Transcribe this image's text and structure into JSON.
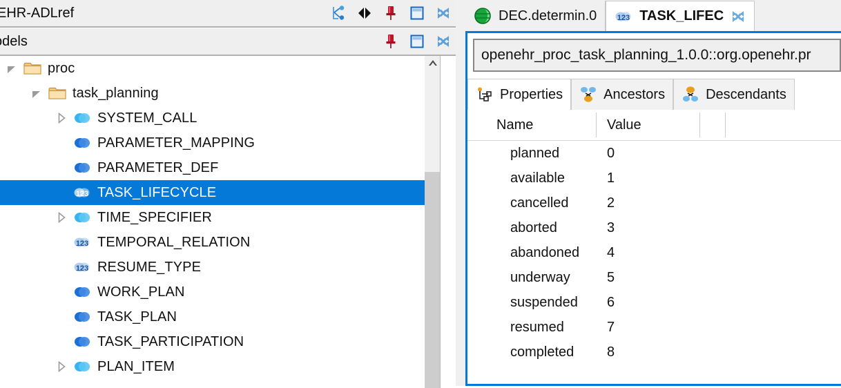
{
  "left": {
    "top_view": {
      "title": "EHR-ADLref",
      "icons": [
        {
          "name": "link-with-editor-icon"
        },
        {
          "name": "collapse-expand-icon"
        },
        {
          "name": "pin-icon"
        },
        {
          "name": "maximize-icon"
        },
        {
          "name": "close-icon"
        }
      ]
    },
    "models_view": {
      "title": "odels",
      "icons": [
        {
          "name": "pin-icon"
        },
        {
          "name": "maximize-icon"
        },
        {
          "name": "close-icon"
        }
      ]
    },
    "tree": [
      {
        "label": "proc",
        "icon": "folder",
        "arrow": "expanded",
        "indent": 0
      },
      {
        "label": "task_planning",
        "icon": "folder",
        "arrow": "expanded",
        "indent": 1
      },
      {
        "label": "SYSTEM_CALL",
        "icon": "class-light",
        "arrow": "collapsed",
        "indent": 2
      },
      {
        "label": "PARAMETER_MAPPING",
        "icon": "class-dark",
        "arrow": "none",
        "indent": 2
      },
      {
        "label": "PARAMETER_DEF",
        "icon": "class-dark",
        "arrow": "none",
        "indent": 2
      },
      {
        "label": "TASK_LIFECYCLE",
        "icon": "enum",
        "arrow": "none",
        "indent": 2,
        "selected": true
      },
      {
        "label": "TIME_SPECIFIER",
        "icon": "class-light",
        "arrow": "collapsed",
        "indent": 2
      },
      {
        "label": "TEMPORAL_RELATION",
        "icon": "enum",
        "arrow": "none",
        "indent": 2
      },
      {
        "label": "RESUME_TYPE",
        "icon": "enum",
        "arrow": "none",
        "indent": 2
      },
      {
        "label": "WORK_PLAN",
        "icon": "class-dark",
        "arrow": "none",
        "indent": 2
      },
      {
        "label": "TASK_PLAN",
        "icon": "class-dark",
        "arrow": "none",
        "indent": 2
      },
      {
        "label": "TASK_PARTICIPATION",
        "icon": "class-dark",
        "arrow": "none",
        "indent": 2
      },
      {
        "label": "PLAN_ITEM",
        "icon": "class-light",
        "arrow": "collapsed",
        "indent": 2
      }
    ]
  },
  "right": {
    "editor_tabs": [
      {
        "label": "DEC.determin.0",
        "icon": "globe-icon",
        "active": false,
        "closable": false
      },
      {
        "label": "TASK_LIFEC",
        "icon": "enum-icon",
        "active": true,
        "closable": true
      }
    ],
    "id_field": {
      "value": "openehr_proc_task_planning_1.0.0::org.openehr.pr",
      "placeholder": ""
    },
    "property_tabs": [
      {
        "label": "Properties",
        "icon": "properties-icon",
        "active": true
      },
      {
        "label": "Ancestors",
        "icon": "ancestors-icon",
        "active": false
      },
      {
        "label": "Descendants",
        "icon": "descendants-icon",
        "active": false
      }
    ],
    "table": {
      "columns": [
        "Name",
        "Value"
      ],
      "rows": [
        {
          "name": "planned",
          "value": "0"
        },
        {
          "name": "available",
          "value": "1"
        },
        {
          "name": "cancelled",
          "value": "2"
        },
        {
          "name": "aborted",
          "value": "3"
        },
        {
          "name": "abandoned",
          "value": "4"
        },
        {
          "name": "underway",
          "value": "5"
        },
        {
          "name": "suspended",
          "value": "6"
        },
        {
          "name": "resumed",
          "value": "7"
        },
        {
          "name": "completed",
          "value": "8"
        }
      ]
    }
  },
  "colors": {
    "selection": "#0479d7",
    "active_border": "#0479d7",
    "header_bg": "#efefef",
    "folder": "#f0bb55",
    "class_light": "#35b4f0",
    "class_dark": "#1d6fd4",
    "enum": "#2a6fc4",
    "pin": "#bb1122"
  }
}
